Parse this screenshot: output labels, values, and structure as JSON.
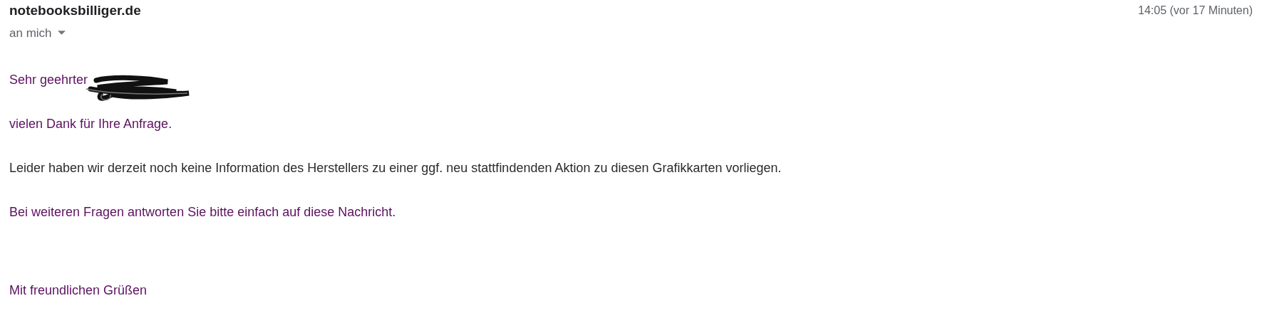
{
  "sender": "notebooksbilliger.de",
  "recipient": "an mich",
  "time": "14:05 (vor 17 Minuten)",
  "body": [
    {
      "kind": "greeting",
      "text": "Sehr geehrter",
      "color": "#5c1060"
    },
    {
      "kind": "paragraph",
      "text": "vielen Dank für Ihre Anfrage.",
      "color": "#5c1060"
    },
    {
      "kind": "paragraph",
      "text": "Leider haben wir derzeit noch keine Information des Herstellers zu einer ggf. neu stattfindenden Aktion zu diesen Grafikkarten vorliegen.",
      "color": "#2b2b2b"
    },
    {
      "kind": "paragraph",
      "text": "Bei weiteren Fragen antworten Sie bitte einfach auf diese Nachricht.",
      "color": "#5c1060"
    },
    {
      "kind": "closing",
      "text": "Mit freundlichen Grüßen",
      "color": "#5c1060"
    }
  ]
}
